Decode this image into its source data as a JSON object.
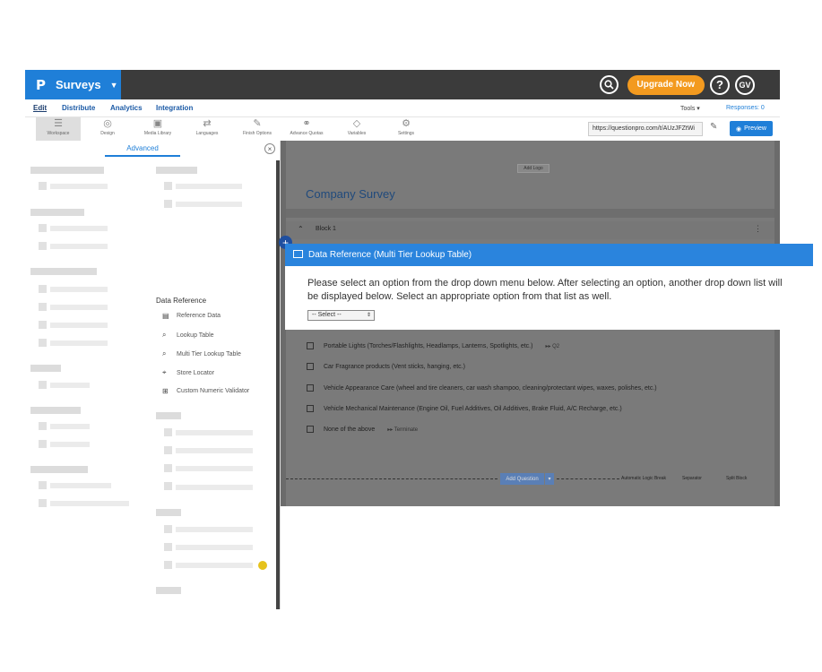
{
  "app": {
    "logo": "P",
    "title": "Surveys",
    "upgrade_label": "Upgrade Now",
    "help_label": "?",
    "user_initials": "GV"
  },
  "nav": {
    "tabs": [
      "Edit",
      "Distribute",
      "Analytics",
      "Integration"
    ],
    "active": "Edit",
    "tools_label": "Tools ▾",
    "responses_label": "Responses: 0"
  },
  "toolbar": {
    "items": [
      {
        "label": "Workspace",
        "icon": "workspace-icon"
      },
      {
        "label": "Design",
        "icon": "palette-icon"
      },
      {
        "label": "Media Library",
        "icon": "image-icon"
      },
      {
        "label": "Languages",
        "icon": "translate-icon"
      },
      {
        "label": "Finish Options",
        "icon": "magic-wand-icon"
      },
      {
        "label": "Advance Quotas",
        "icon": "quota-icon"
      },
      {
        "label": "Variables",
        "icon": "tag-icon"
      },
      {
        "label": "Settings",
        "icon": "gear-icon"
      }
    ],
    "url": "https://questionpro.com/t/AUzJFZtWi",
    "preview_label": "Preview"
  },
  "panel": {
    "active_tab": "Advanced",
    "data_reference": {
      "title": "Data Reference",
      "items": [
        {
          "label": "Reference Data",
          "icon": "reference-data-icon"
        },
        {
          "label": "Lookup Table",
          "icon": "lookup-table-icon"
        },
        {
          "label": "Multi Tier Lookup Table",
          "icon": "multi-tier-lookup-icon"
        },
        {
          "label": "Store Locator",
          "icon": "location-pin-icon"
        },
        {
          "label": "Custom Numeric Validator",
          "icon": "numeric-validator-icon"
        }
      ]
    }
  },
  "canvas": {
    "add_logo": "Add Logo",
    "survey_title": "Company Survey",
    "block_name": "Block 1",
    "options": [
      {
        "text": "Portable Lights (Torches/Flashlights, Headlamps, Lanterns, Spotlights, etc.)",
        "logic": "▸▸ Q2"
      },
      {
        "text": "Car Fragrance products (Vent sticks, hanging, etc.)",
        "logic": ""
      },
      {
        "text": "Vehicle Appearance Care (wheel and tire cleaners, car wash shampoo, cleaning/protectant wipes, waxes, polishes, etc.)",
        "logic": ""
      },
      {
        "text": "Vehicle Mechanical Maintenance (Engine Oil, Fuel Additives, Oil Additives, Brake Fluid, A/C Recharge, etc.)",
        "logic": ""
      },
      {
        "text": "None of the above",
        "logic": "▸▸ Terminate"
      }
    ],
    "add_question": "Add Question",
    "breaks": [
      "Automatic Logic Break",
      "Separator",
      "Split Block"
    ]
  },
  "modal": {
    "title": "Data Reference (Multi Tier Lookup Table)",
    "body": "Please select an option from the drop down menu below. After selecting an option, another drop down list will be displayed below. Select an appropriate option from that list as well.",
    "select_value": "-- Select --"
  },
  "colors": {
    "brand_blue": "#1f7fd8",
    "topbar": "#3b3b3b",
    "upgrade_orange": "#f39a1f",
    "modal_header": "#2a84dd"
  }
}
